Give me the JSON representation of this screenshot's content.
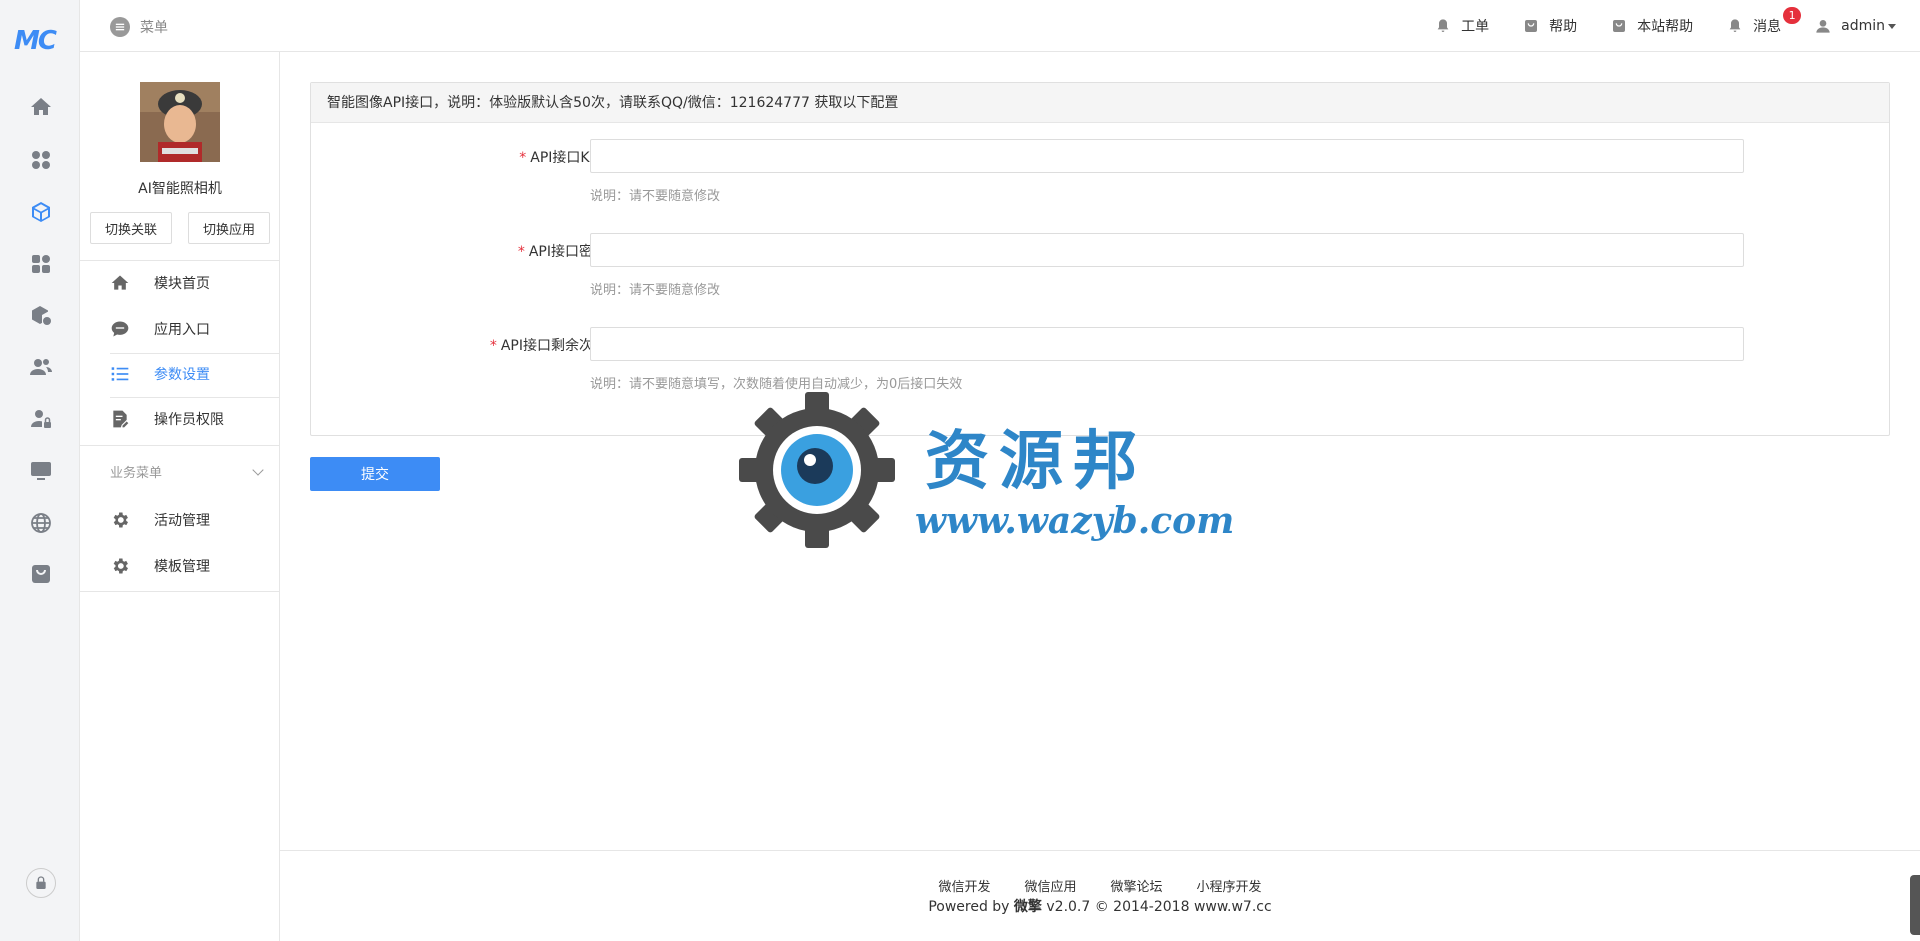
{
  "brand": {
    "logo_text": "MC",
    "accent": "#3d8cf5"
  },
  "rail": {
    "icons": [
      "home-icon",
      "apps-icon",
      "cube-icon",
      "modules-icon",
      "package-settings-icon",
      "users-icon",
      "user-lock-icon",
      "monitor-icon",
      "globe-icon",
      "bag-icon",
      "lock-icon"
    ],
    "active": "cube-icon"
  },
  "header": {
    "menu_label": "菜单",
    "items": [
      {
        "icon": "bell-icon",
        "label": "工单"
      },
      {
        "icon": "bag-icon",
        "label": "帮助"
      },
      {
        "icon": "bag-icon",
        "label": "本站帮助"
      },
      {
        "icon": "bell-icon",
        "label": "消息",
        "badge": "1"
      }
    ],
    "user": "admin"
  },
  "sidebar": {
    "app_name": "AI智能照相机",
    "switch_link": "切换关联",
    "switch_app": "切换应用",
    "items": [
      {
        "icon": "house-icon",
        "label": "模块首页"
      },
      {
        "icon": "chat-icon",
        "label": "应用入口"
      },
      {
        "icon": "list-icon",
        "label": "参数设置",
        "active": true
      },
      {
        "icon": "edit-doc-icon",
        "label": "操作员权限"
      }
    ],
    "group_label": "业务菜单",
    "group_items": [
      {
        "icon": "gear-icon",
        "label": "活动管理"
      },
      {
        "icon": "gear-icon",
        "label": "模板管理"
      }
    ]
  },
  "panel": {
    "title": "智能图像API接口，说明：体验版默认含50次，请联系QQ/微信：121624777 获取以下配置",
    "fields": [
      {
        "label": "API接口KEY",
        "value": "",
        "help": "说明：请不要随意修改"
      },
      {
        "label": "API接口密钥",
        "value": "",
        "help": "说明：请不要随意修改"
      },
      {
        "label": "API接口剩余次数",
        "value": "",
        "help": "说明：请不要随意填写，次数随着使用自动减少，为0后接口失效"
      }
    ],
    "required_mark": "*"
  },
  "submit_label": "提交",
  "watermark": {
    "cn": "资源邦",
    "url": "www.wazyb.com"
  },
  "footer": {
    "links": [
      "微信开发",
      "微信应用",
      "微擎论坛",
      "小程序开发"
    ],
    "powered_prefix": "Powered by ",
    "powered_brand": "微擎",
    "powered_suffix": " v2.0.7 © 2014-2018 www.w7.cc"
  }
}
